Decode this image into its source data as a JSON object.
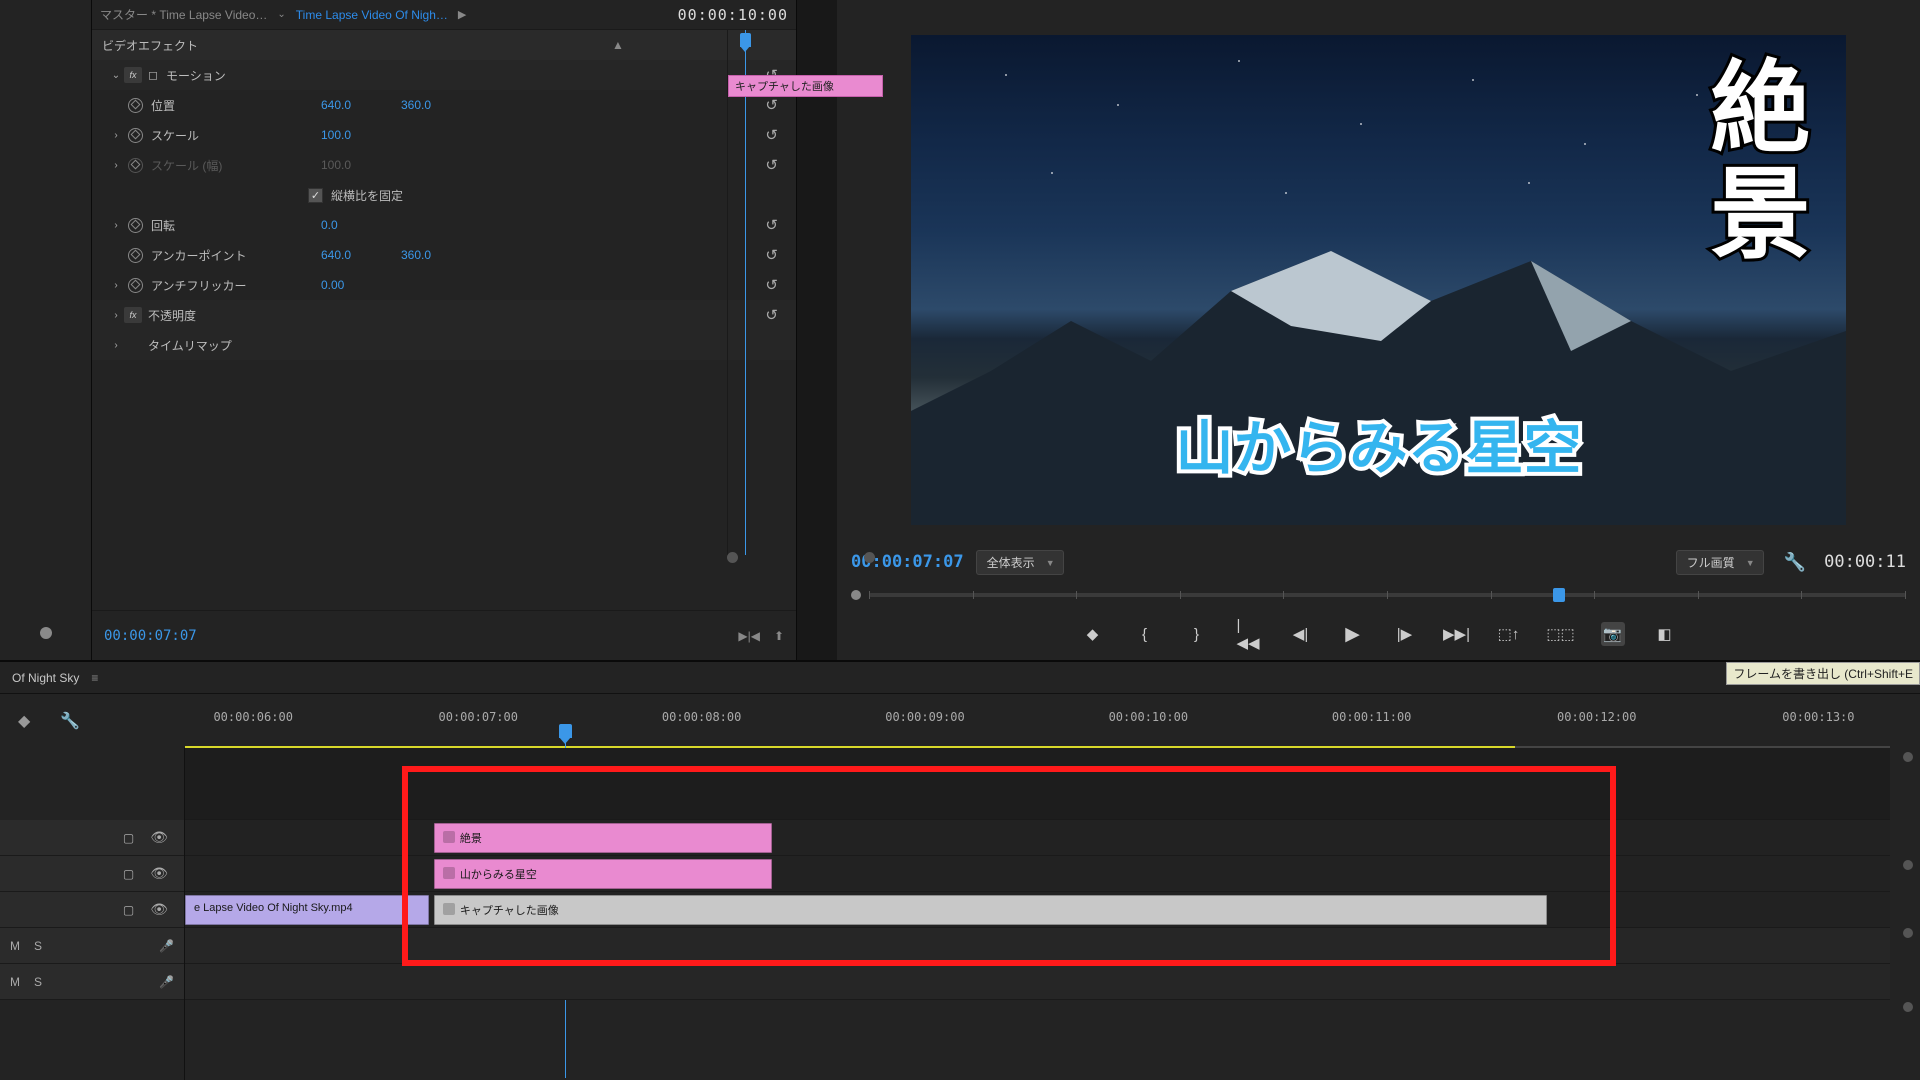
{
  "header": {
    "master_crumb": "マスター * Time Lapse Video…",
    "clip_crumb": "Time Lapse Video Of Nigh…",
    "timecode_right": "00:00:10:00"
  },
  "keyframe_clip": "キャプチャした画像",
  "sections": {
    "video_effects": "ビデオエフェクト",
    "motion": "モーション",
    "opacity": "不透明度",
    "time_remap": "タイムリマップ"
  },
  "props": {
    "position_label": "位置",
    "position_x": "640.0",
    "position_y": "360.0",
    "scale_label": "スケール",
    "scale_val": "100.0",
    "scale_w_label": "スケール (幅)",
    "scale_w_val": "100.0",
    "uniform_label": "縦横比を固定",
    "rotation_label": "回転",
    "rotation_val": "0.0",
    "anchor_label": "アンカーポイント",
    "anchor_x": "640.0",
    "anchor_y": "360.0",
    "antiflicker_label": "アンチフリッカー",
    "antiflicker_val": "0.00"
  },
  "footer_time": "00:00:07:07",
  "program": {
    "timecode_left": "00:00:07:07",
    "view_mode": "全体表示",
    "quality": "フル画質",
    "timecode_right": "00:00:11",
    "overlay_vertical": "絶景",
    "overlay_horizontal": "山からみる星空",
    "tooltip": "フレームを書き出し (Ctrl+Shift+E"
  },
  "sequence_tab": "Of Night Sky",
  "ruler": {
    "marks": [
      "00:00:06:00",
      "00:00:07:00",
      "00:00:08:00",
      "00:00:09:00",
      "00:00:10:00",
      "00:00:11:00",
      "00:00:12:00",
      "00:00:13:0"
    ],
    "positions_pct": [
      4,
      17.2,
      30.3,
      43.4,
      56.5,
      69.6,
      82.8,
      95.8
    ]
  },
  "playhead_pct": 21.9,
  "track_heads_audio": {
    "m": "M",
    "s": "S"
  },
  "clips": {
    "v3": {
      "label": "絶景",
      "left_pct": 14.6,
      "width_pct": 19.8
    },
    "v2": {
      "label": "山からみる星空",
      "left_pct": 14.6,
      "width_pct": 19.8
    },
    "v1a": {
      "label": "e Lapse Video Of Night Sky.mp4",
      "left_pct": 0,
      "width_pct": 14.3
    },
    "v1b": {
      "label": "キャプチャした画像",
      "left_pct": 14.6,
      "width_pct": 65.3
    }
  }
}
